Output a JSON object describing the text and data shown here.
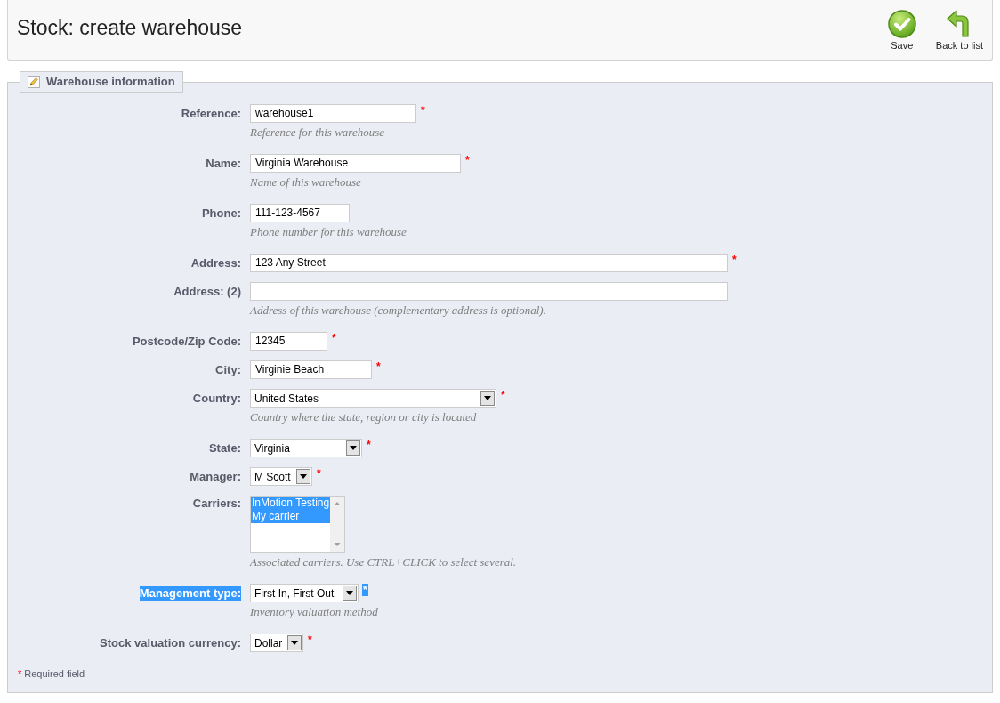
{
  "header": {
    "title": "Stock: create warehouse",
    "toolbar": [
      {
        "kind": "save",
        "label": "Save"
      },
      {
        "kind": "back",
        "label": "Back to list"
      }
    ]
  },
  "form": {
    "legend": "Warehouse information",
    "fields": [
      {
        "kind": "text",
        "label": "Reference:",
        "value": "warehouse1",
        "required_mark": "*",
        "hint": "Reference for this warehouse",
        "text_selected": false
      },
      {
        "kind": "text",
        "label": "Name:",
        "value": "Virginia Warehouse",
        "required_mark": "*",
        "hint": "Name of this warehouse",
        "text_selected": false
      },
      {
        "kind": "text",
        "label": "Phone:",
        "value": "111-123-4567",
        "hint": "Phone number for this warehouse",
        "text_selected": false
      },
      {
        "kind": "text",
        "label": "Address:",
        "value": "123 Any Street",
        "required_mark": "*",
        "text_selected": false
      },
      {
        "kind": "text",
        "label": "Address: (2)",
        "hint": "Address of this warehouse (complementary address is optional).",
        "text_selected": false
      },
      {
        "kind": "text",
        "label": "Postcode/Zip Code:",
        "value": "12345",
        "required_mark": "*",
        "text_selected": false
      },
      {
        "kind": "text",
        "label": "City:",
        "value": "Virginie Beach",
        "required_mark": "*",
        "text_selected": false
      },
      {
        "kind": "select",
        "label": "Country:",
        "value": "United States",
        "required_mark": "*",
        "hint": "Country where the state, region or city is located",
        "text_selected": false
      },
      {
        "kind": "select",
        "label": "State:",
        "value": "Virginia",
        "required_mark": "*",
        "text_selected": false
      },
      {
        "kind": "select",
        "label": "Manager:",
        "value": "M Scott",
        "required_mark": "*",
        "text_selected": false
      },
      {
        "kind": "listbox",
        "label": "Carriers:",
        "options": [
          {
            "label": "InMotion Testing",
            "selected": true
          },
          {
            "label": "My carrier",
            "selected": true
          }
        ],
        "hint": "Associated carriers. Use CTRL+CLICK to select several.",
        "text_selected": false
      },
      {
        "kind": "select",
        "label": "Management type:",
        "value": "First In, First Out",
        "required_mark": "*",
        "hint": "Inventory valuation method",
        "text_selected": true
      },
      {
        "kind": "select",
        "label": "Stock valuation currency:",
        "value": "Dollar",
        "required_mark": "*",
        "text_selected": false
      }
    ],
    "footnote": {
      "mark": "*",
      "text": "Required field"
    }
  }
}
